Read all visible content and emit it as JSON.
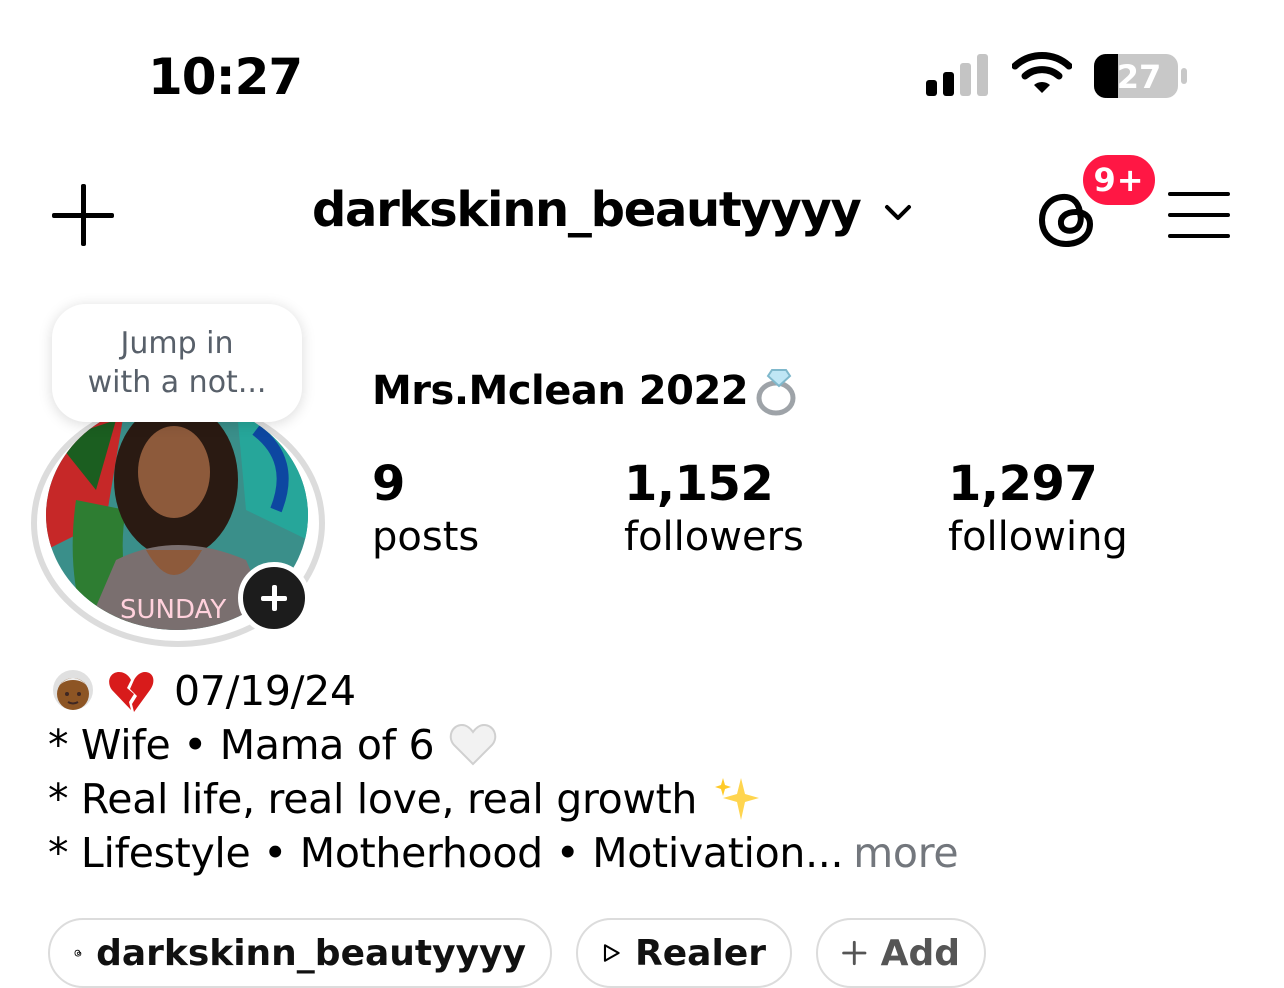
{
  "status_bar": {
    "time": "10:27",
    "battery": "27"
  },
  "header": {
    "username": "darkskinn_beautyyyy",
    "notification_badge": "9+"
  },
  "avatar": {
    "tooltip_line1": "Jump in",
    "tooltip_line2": "with a not...",
    "overlay_text": "SUNDAY"
  },
  "profile": {
    "display_name": "Mrs.Mclean 2022",
    "stats": [
      {
        "value": "9",
        "label": "posts"
      },
      {
        "value": "1,152",
        "label": "followers"
      },
      {
        "value": "1,297",
        "label": "following"
      }
    ]
  },
  "bio": {
    "line1": "07/19/24",
    "line2": "* Wife • Mama of 6",
    "line3": "* Real life, real love, real growth",
    "line4": "* Lifestyle • Motherhood • Motivation",
    "ellipsis": "...",
    "more": "more"
  },
  "links": {
    "threads": "darkskinn_beautyyyy",
    "realer": "Realer",
    "add": "Add"
  },
  "colors": {
    "badge": "#ff1744",
    "more_text": "#73777d",
    "pill_border": "#dcdcdc"
  }
}
